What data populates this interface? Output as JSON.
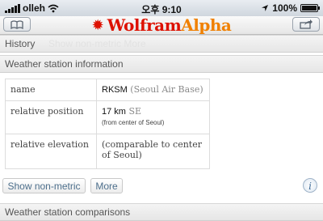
{
  "status_bar": {
    "carrier": "olleh",
    "time": "오후 9:10",
    "battery": "100%",
    "battery_level": 1.0
  },
  "nav": {
    "logo_main": "Wolfram",
    "logo_accent": "Alpha",
    "left_icon": "book-icon",
    "right_icon": "share-icon"
  },
  "sections": {
    "history": "History",
    "history_ghost": "Show non-metric   More",
    "station_info": "Weather station information",
    "station_comparisons": "Weather station comparisons"
  },
  "table": {
    "rows": [
      {
        "label": "name",
        "value": "RKSM",
        "note": "(Seoul Air Base)"
      },
      {
        "label": "relative position",
        "value": "17 km",
        "note": "SE",
        "sub": "(from center of Seoul)"
      },
      {
        "label": "relative elevation",
        "note": "(comparable to center of Seoul)"
      }
    ]
  },
  "buttons": {
    "show_non_metric": "Show non-metric",
    "more": "More",
    "info": "i"
  },
  "colors": {
    "brand": "#dd1100",
    "brand_accent": "#f08000",
    "link": "#4d6f8c"
  }
}
